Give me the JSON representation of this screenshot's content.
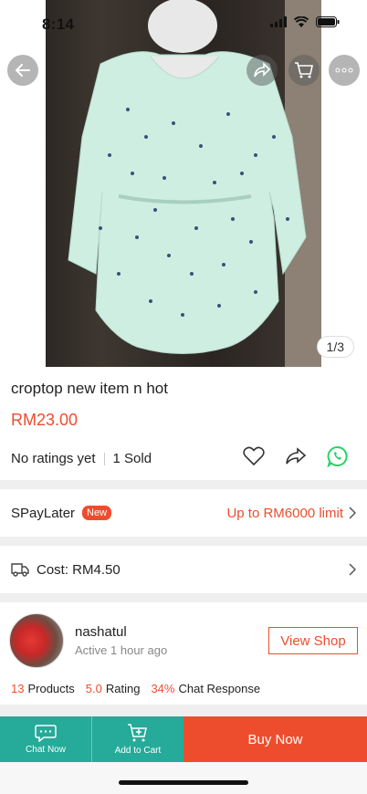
{
  "status": {
    "time": "8:14"
  },
  "gallery": {
    "indicator": "1/3"
  },
  "product": {
    "title": "croptop new item n hot",
    "price": "RM23.00",
    "ratings": "No ratings yet",
    "sold": "1 Sold"
  },
  "spaylater": {
    "label": "SPayLater",
    "badge": "New",
    "limit": "Up to RM6000 limit"
  },
  "shipping": {
    "cost": "Cost: RM4.50"
  },
  "shop": {
    "name": "nashatul",
    "active": "Active 1 hour ago",
    "view_label": "View Shop",
    "products_num": "13",
    "products_label": "Products",
    "rating_num": "5.0",
    "rating_label": "Rating",
    "chat_num": "34%",
    "chat_label": "Chat Response"
  },
  "bottom_bar": {
    "chat_now": "Chat Now",
    "add_to_cart": "Add to Cart",
    "buy_now": "Buy Now"
  },
  "colors": {
    "accent": "#ee4d2d",
    "teal": "#26aa99",
    "whatsapp": "#25d366"
  }
}
